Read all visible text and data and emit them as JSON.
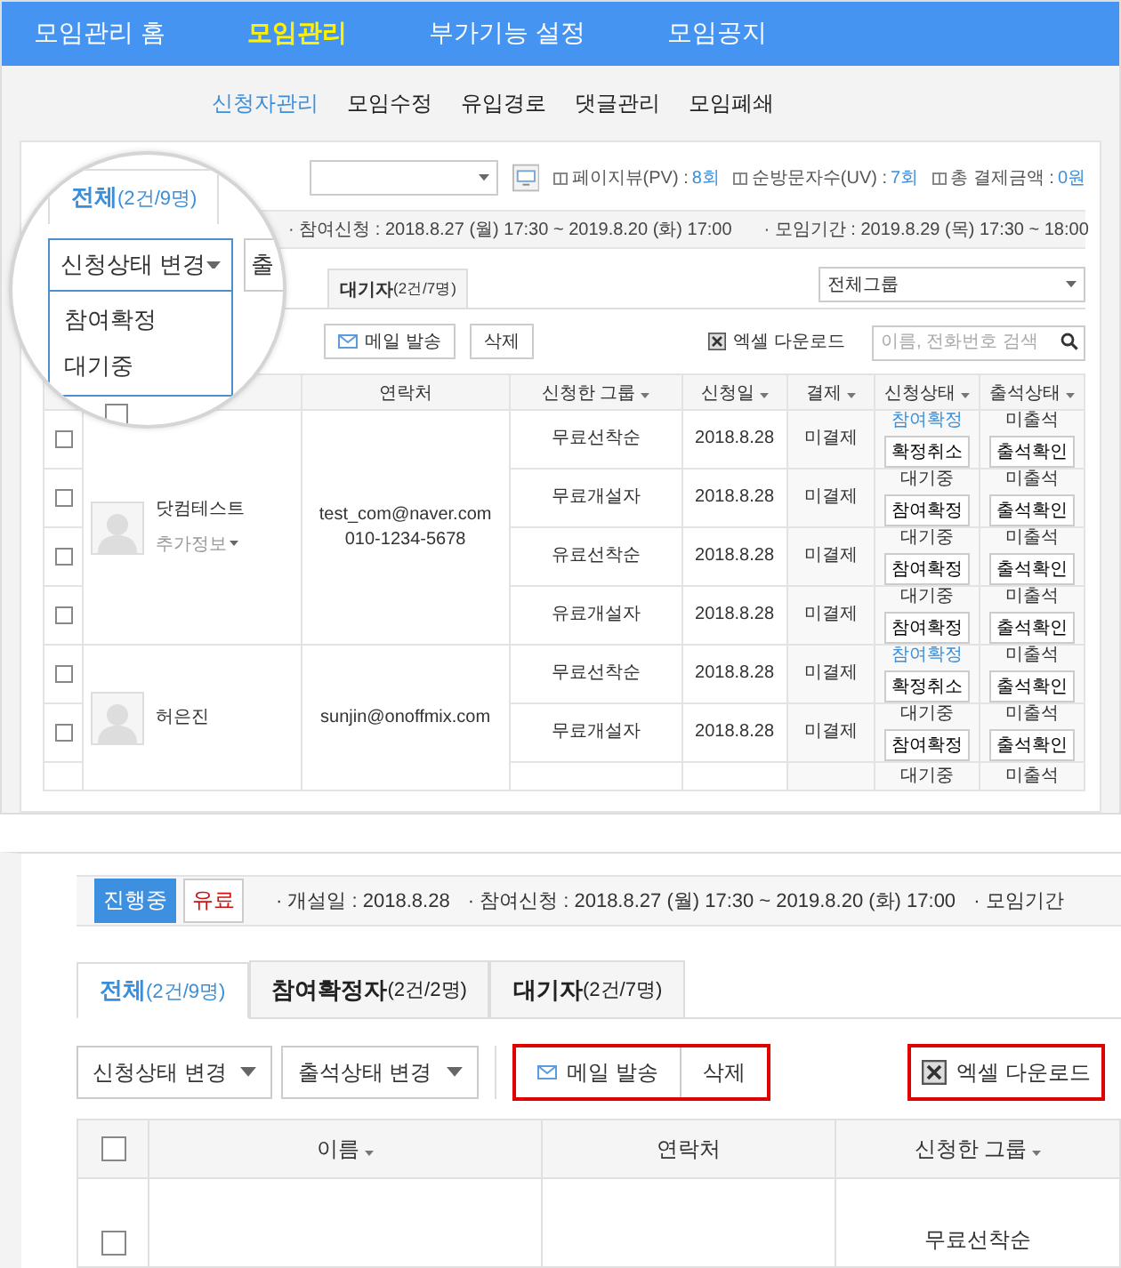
{
  "nav": [
    {
      "label": "모임관리 홈",
      "selected": false
    },
    {
      "label": "모임관리",
      "selected": true
    },
    {
      "label": "부가기능 설정",
      "selected": false
    },
    {
      "label": "모임공지",
      "selected": false
    }
  ],
  "subnav": [
    {
      "label": "신청자관리",
      "selected": true
    },
    {
      "label": "모임수정",
      "selected": false
    },
    {
      "label": "유입경로",
      "selected": false
    },
    {
      "label": "댓글관리",
      "selected": false
    },
    {
      "label": "모임폐쇄",
      "selected": false
    }
  ],
  "overview": {
    "stats": [
      {
        "label": "페이지뷰(PV) : ",
        "value": "8회"
      },
      {
        "label": "순방문자수(UV) : ",
        "value": "7회"
      },
      {
        "label": "총 결제금액 : ",
        "value": "0원"
      }
    ],
    "info": [
      "· 참여신청 : 2018.8.27 (월) 17:30 ~ 2019.8.20 (화) 17:00",
      "· 모임기간 : 2019.8.29 (목) 17:30 ~ 18:00"
    ],
    "tab": {
      "label": "대기자",
      "count": "(2건/7명)",
      "selected": false
    },
    "group_select": "전체그룹",
    "buttons": [
      "메일 발송",
      "삭제"
    ],
    "excel": "엑셀 다운로드",
    "search": {
      "placeholder": "이름, 전화번호 검색"
    },
    "columns": [
      {
        "label": "연락처",
        "sortable": false
      },
      {
        "label": "신청한 그룹",
        "sortable": true
      },
      {
        "label": "신청일",
        "sortable": true
      },
      {
        "label": "결제",
        "sortable": true
      },
      {
        "label": "신청상태",
        "sortable": true
      },
      {
        "label": "출석상태",
        "sortable": true
      }
    ],
    "applicants": [
      {
        "name": "닷컴테스트",
        "extra": "추가정보",
        "contact": [
          "test_com@naver.com",
          "010-1234-5678"
        ],
        "rows": [
          {
            "kind": "full",
            "checked": false,
            "group": "무료선착순",
            "date": "2018.8.28",
            "payment": "미결제",
            "status": "참여확정",
            "confirmed": true,
            "status_button": "확정취소",
            "attendance": "미출석",
            "attendance_button": "출석확인"
          },
          {
            "kind": "full",
            "checked": false,
            "group": "무료개설자",
            "date": "2018.8.28",
            "payment": "미결제",
            "status": "대기중",
            "confirmed": false,
            "status_button": "참여확정",
            "attendance": "미출석",
            "attendance_button": "출석확인"
          },
          {
            "kind": "full",
            "checked": false,
            "group": "유료선착순",
            "date": "2018.8.28",
            "payment": "미결제",
            "status": "대기중",
            "confirmed": false,
            "status_button": "참여확정",
            "attendance": "미출석",
            "attendance_button": "출석확인"
          },
          {
            "kind": "full",
            "checked": false,
            "group": "유료개설자",
            "date": "2018.8.28",
            "payment": "미결제",
            "status": "대기중",
            "confirmed": false,
            "status_button": "참여확정",
            "attendance": "미출석",
            "attendance_button": "출석확인"
          }
        ]
      },
      {
        "name": "허은진",
        "contact": [
          "sunjin@onoffmix.com"
        ],
        "rows": [
          {
            "kind": "full",
            "checked": false,
            "group": "무료선착순",
            "date": "2018.8.28",
            "payment": "미결제",
            "status": "참여확정",
            "confirmed": true,
            "status_button": "확정취소",
            "attendance": "미출석",
            "attendance_button": "출석확인"
          },
          {
            "kind": "full",
            "checked": false,
            "group": "무료개설자",
            "date": "2018.8.28",
            "payment": "미결제",
            "status": "대기중",
            "confirmed": false,
            "status_button": "참여확정",
            "attendance": "미출석",
            "attendance_button": "출석확인"
          },
          {
            "kind": "cut",
            "status": "대기중",
            "confirmed": false,
            "attendance": "미출석"
          }
        ]
      }
    ]
  },
  "magnifier": {
    "tab": {
      "label": "전체",
      "count": "(2건/9명)",
      "selected": true
    },
    "dropdown": "신청상태 변경",
    "menu": [
      "참여확정",
      "대기중"
    ],
    "cut_button": "출",
    "checked": false
  },
  "detail": {
    "badges": [
      {
        "label": "진행중",
        "kind": "status"
      },
      {
        "label": "유료",
        "kind": "price"
      }
    ],
    "info": [
      "· 개설일 : 2018.8.28",
      "· 참여신청 : 2018.8.27 (월) 17:30 ~ 2019.8.20 (화) 17:00",
      "· 모임기간"
    ],
    "tabs": [
      {
        "label": "전체",
        "count": "(2건/9명)",
        "selected": true
      },
      {
        "label": "참여확정자",
        "count": "(2건/2명)",
        "selected": false
      },
      {
        "label": "대기자",
        "count": "(2건/7명)",
        "selected": false
      }
    ],
    "dropdowns": [
      "신청상태 변경",
      "출석상태 변경"
    ],
    "buttons": [
      "메일 발송",
      "삭제"
    ],
    "excel": "엑셀 다운로드",
    "highlighted": true,
    "all_checked": false,
    "columns": [
      {
        "label": "이름",
        "sortable": true
      },
      {
        "label": "연락처",
        "sortable": false
      },
      {
        "label": "신청한 그룹",
        "sortable": true
      }
    ],
    "row": {
      "checked": false,
      "group": "무료선착순"
    }
  }
}
